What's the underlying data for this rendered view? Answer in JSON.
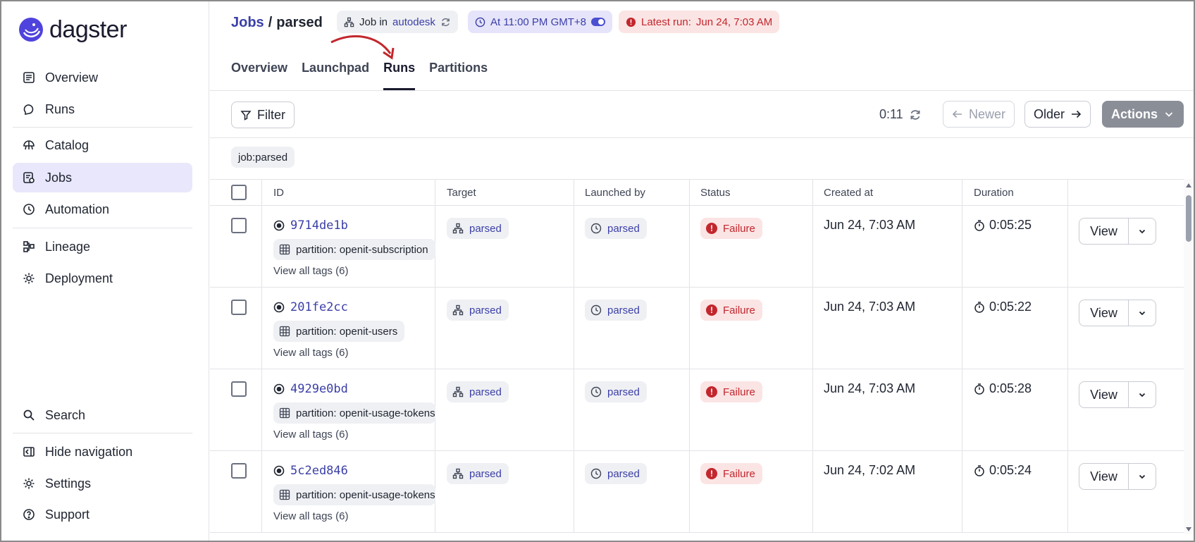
{
  "app": {
    "name": "dagster"
  },
  "sidebar": {
    "items": [
      {
        "label": "Overview",
        "icon": "overview-icon"
      },
      {
        "label": "Runs",
        "icon": "runs-icon"
      },
      {
        "label": "Catalog",
        "icon": "catalog-icon"
      },
      {
        "label": "Jobs",
        "icon": "jobs-icon",
        "active": true
      },
      {
        "label": "Automation",
        "icon": "automation-icon"
      },
      {
        "label": "Lineage",
        "icon": "lineage-icon"
      },
      {
        "label": "Deployment",
        "icon": "deployment-icon"
      },
      {
        "label": "Search",
        "icon": "search-icon"
      },
      {
        "label": "Hide navigation",
        "icon": "hide-navigation-icon"
      },
      {
        "label": "Settings",
        "icon": "settings-icon"
      },
      {
        "label": "Support",
        "icon": "support-icon"
      }
    ]
  },
  "header": {
    "breadcrumb_root": "Jobs",
    "breadcrumb_sep": "/",
    "job_name": "parsed",
    "job_pill_prefix": "Job in",
    "job_pill_repo": "autodesk",
    "schedule_label": "At 11:00 PM GMT+8",
    "latest_run_label": "Latest run:",
    "latest_run_time": "Jun 24, 7:03 AM",
    "tabs": [
      "Overview",
      "Launchpad",
      "Runs",
      "Partitions"
    ],
    "active_tab": "Runs"
  },
  "toolbar": {
    "filter_label": "Filter",
    "refresh_countdown": "0:11",
    "newer_label": "Newer",
    "older_label": "Older",
    "actions_label": "Actions",
    "active_filter_tag": "job:parsed"
  },
  "table": {
    "columns": [
      "ID",
      "Target",
      "Launched by",
      "Status",
      "Created at",
      "Duration"
    ],
    "view_label": "View",
    "rows": [
      {
        "id": "9714de1b",
        "partition": "partition: openit-subscription",
        "tags": "View all tags (6)",
        "target": "parsed",
        "launched_by": "parsed",
        "status": "Failure",
        "created": "Jun 24, 7:03 AM",
        "duration": "0:05:25"
      },
      {
        "id": "201fe2cc",
        "partition": "partition: openit-users",
        "tags": "View all tags (6)",
        "target": "parsed",
        "launched_by": "parsed",
        "status": "Failure",
        "created": "Jun 24, 7:03 AM",
        "duration": "0:05:22"
      },
      {
        "id": "4929e0bd",
        "partition": "partition: openit-usage-tokens",
        "tags": "View all tags (6)",
        "target": "parsed",
        "launched_by": "parsed",
        "status": "Failure",
        "created": "Jun 24, 7:03 AM",
        "duration": "0:05:28"
      },
      {
        "id": "5c2ed846",
        "partition": "partition: openit-usage-tokens",
        "tags": "View all tags (6)",
        "target": "parsed",
        "launched_by": "parsed",
        "status": "Failure",
        "created": "Jun 24, 7:02 AM",
        "duration": "0:05:24"
      }
    ]
  },
  "colors": {
    "accent": "#3b3fa7",
    "failure": "#c2272d",
    "active_nav": "#e8e7fb"
  }
}
